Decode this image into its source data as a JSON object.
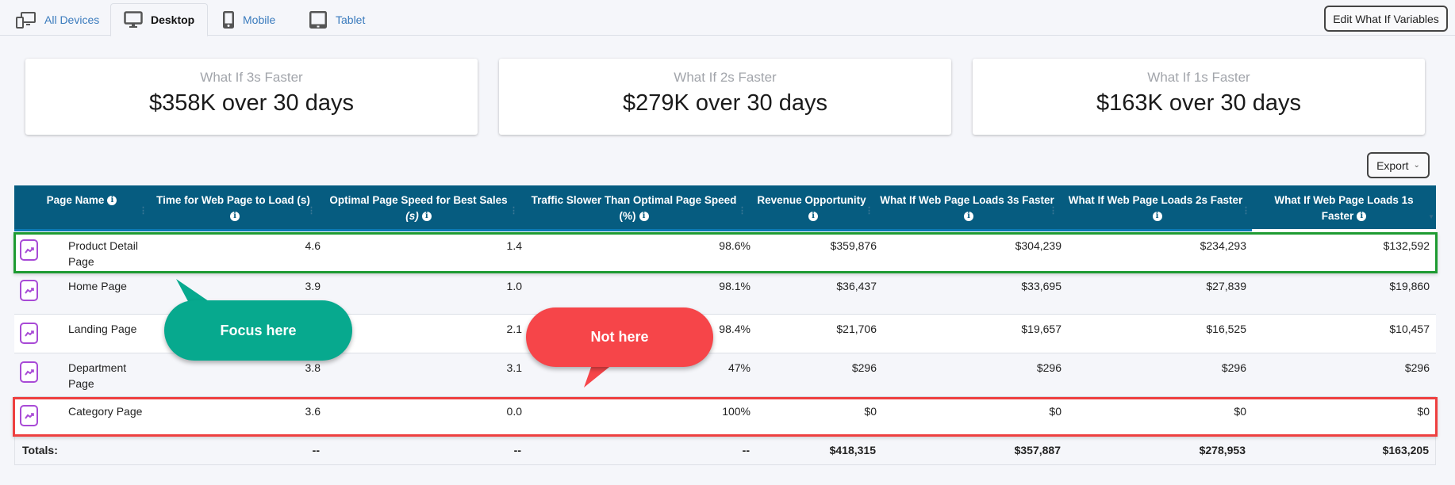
{
  "tabs": [
    {
      "label": "All Devices",
      "icon": "all-devices-icon",
      "active": false
    },
    {
      "label": "Desktop",
      "icon": "desktop-icon",
      "active": true
    },
    {
      "label": "Mobile",
      "icon": "mobile-icon",
      "active": false
    },
    {
      "label": "Tablet",
      "icon": "tablet-icon",
      "active": false
    }
  ],
  "edit_button": "Edit What If Variables",
  "cards": [
    {
      "label": "What If 3s Faster",
      "value": "$358K over 30 days"
    },
    {
      "label": "What If 2s Faster",
      "value": "$279K over 30 days"
    },
    {
      "label": "What If 1s Faster",
      "value": "$163K over 30 days"
    }
  ],
  "export_button": "Export",
  "table": {
    "columns": [
      {
        "line1": "Page Name",
        "line2": ""
      },
      {
        "line1": "Time for Web Page to Load (s)",
        "line2": ""
      },
      {
        "line1": "Optimal Page Speed for Best Sales",
        "line2": "(s)"
      },
      {
        "line1": "Traffic Slower Than Optimal Page Speed",
        "line2": "(%)"
      },
      {
        "line1": "Revenue Opportunity",
        "line2": ""
      },
      {
        "line1": "What If Web Page Loads 3s Faster",
        "line2": ""
      },
      {
        "line1": "What If Web Page Loads 2s Faster",
        "line2": ""
      },
      {
        "line1": "What If Web Page Loads 1s",
        "line2": "Faster"
      }
    ],
    "rows": [
      {
        "name": "Product Detail Page",
        "load": "4.6",
        "optimal": "1.4",
        "slower": "98.6%",
        "revenue": "$359,876",
        "w3": "$304,239",
        "w2": "$234,293",
        "w1": "$132,592"
      },
      {
        "name": "Home Page",
        "load": "3.9",
        "optimal": "1.0",
        "slower": "98.1%",
        "revenue": "$36,437",
        "w3": "$33,695",
        "w2": "$27,839",
        "w1": "$19,860"
      },
      {
        "name": "Landing Page",
        "load": "",
        "optimal": "2.1",
        "slower": "98.4%",
        "revenue": "$21,706",
        "w3": "$19,657",
        "w2": "$16,525",
        "w1": "$10,457"
      },
      {
        "name": "Department Page",
        "load": "3.8",
        "optimal": "3.1",
        "slower": "47%",
        "revenue": "$296",
        "w3": "$296",
        "w2": "$296",
        "w1": "$296"
      },
      {
        "name": "Category Page",
        "load": "3.6",
        "optimal": "0.0",
        "slower": "100%",
        "revenue": "$0",
        "w3": "$0",
        "w2": "$0",
        "w1": "$0"
      }
    ],
    "totals": {
      "label": "Totals:",
      "load": "--",
      "optimal": "--",
      "slower": "--",
      "revenue": "$418,315",
      "w3": "$357,887",
      "w2": "$278,953",
      "w1": "$163,205"
    }
  },
  "annotations": {
    "focus": "Focus here",
    "not": "Not here"
  },
  "colors": {
    "header_bg": "#065c80",
    "focus_green": "#07a98e",
    "not_red": "#f64549",
    "highlight_green": "#1e9b32",
    "highlight_red": "#ee4040",
    "trend_purple": "#a84ad6"
  }
}
